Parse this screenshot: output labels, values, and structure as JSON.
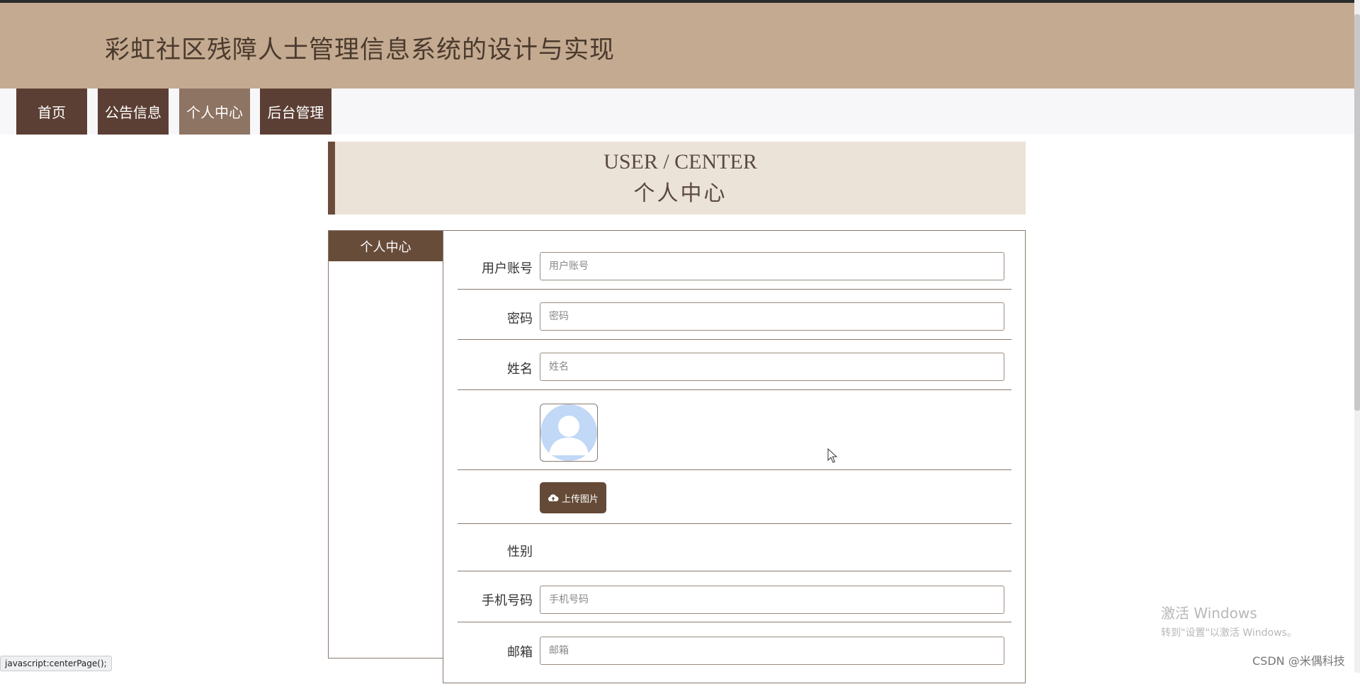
{
  "header": {
    "title": "彩虹社区残障人士管理信息系统的设计与实现"
  },
  "nav": {
    "items": [
      {
        "label": "首页"
      },
      {
        "label": "公告信息"
      },
      {
        "label": "个人中心"
      },
      {
        "label": "后台管理"
      }
    ],
    "active_index": 2
  },
  "banner": {
    "en": "USER / CENTER",
    "cn": "个人中心"
  },
  "sidebar": {
    "heading": "个人中心"
  },
  "form": {
    "username": {
      "label": "用户账号",
      "placeholder": "用户账号",
      "value": ""
    },
    "password": {
      "label": "密码",
      "placeholder": "密码",
      "value": ""
    },
    "name": {
      "label": "姓名",
      "placeholder": "姓名",
      "value": ""
    },
    "upload_label": "上传图片",
    "gender": {
      "label": "性别"
    },
    "phone": {
      "label": "手机号码",
      "placeholder": "手机号码",
      "value": ""
    },
    "email": {
      "label": "邮箱",
      "placeholder": "邮箱",
      "value": ""
    }
  },
  "status_bar": {
    "text": "javascript:centerPage();"
  },
  "watermark": {
    "line1": "激活 Windows",
    "line2": "转到\"设置\"以激活 Windows。"
  },
  "csdn": {
    "text": "CSDN @米偶科技"
  },
  "colors": {
    "header_bg": "#c4aa90",
    "nav_item": "#5c3f34",
    "nav_active": "#8e7463",
    "banner_bg": "#ece3d8",
    "accent": "#654a37"
  },
  "icons": {
    "upload": "cloud-upload-icon",
    "avatar": "user-avatar-placeholder-icon"
  }
}
